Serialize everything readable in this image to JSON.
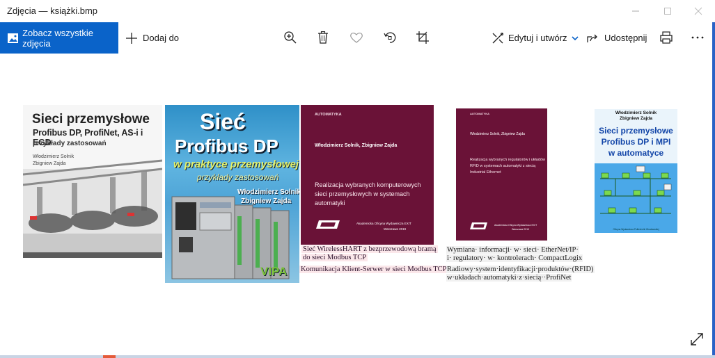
{
  "window": {
    "title": "Zdjęcia — książki.bmp"
  },
  "toolbar": {
    "see_all_label": "Zobacz wszystkie zdjęcia",
    "add_label": "Dodaj do",
    "edit_label": "Edytuj i utwórz",
    "share_label": "Udostępnij",
    "icons": [
      "zoom-icon",
      "delete-icon",
      "favorite-icon",
      "rotate-icon",
      "crop-icon",
      "edit-icon",
      "share-icon",
      "print-icon",
      "more-icon"
    ]
  },
  "colors": {
    "accent": "#0a63c9",
    "book_maroon": "#6a1237",
    "cover_blue": "#4aa8e8"
  },
  "books": {
    "b1": {
      "title_line1": "Sieci przemysłowe",
      "title_line2": "Profibus DP, ProfiNet, AS-i i EGD",
      "subtitle": "przykłady zastosowań",
      "author1": "Włodzimierz Solnik",
      "author2": "Zbigniew Zajda"
    },
    "b2": {
      "title_line1": "Sieć",
      "title_line2": "Profibus DP",
      "title_line3": "w praktyce przemysłowej",
      "subtitle": "przykłady zastosowań",
      "author1": "Włodzimierz Solnik",
      "author2": "Zbigniew Zajda",
      "publisher": "VIPA"
    },
    "b3": {
      "series": "AUTOMATYKA",
      "authors": "Włodzimierz Solnik, Zbigniew Zajda",
      "title": "Realizacja wybranych komputerowych sieci przemysłowych w systemach automatyki",
      "publisher": "Akademicka Oficyna Wydawnicza EXIT",
      "place_year": "Warszawa 2019"
    },
    "b4": {
      "series": "AUTOMATYKA",
      "authors": "Włodzimierz Solnik, Zbigniew Zajda",
      "title": "Realizacja wybranych regulatorów i układów RFID w systemach automatyki z siecią Industrial Ethernet",
      "publisher": "Akademicka Oficyna Wydawnicza EXIT",
      "place_year": "Warszawa 2019"
    },
    "b5": {
      "author1": "Włodzimierz Solnik",
      "author2": "Zbigniew Zajda",
      "title_line1": "Sieci przemysłowe",
      "title_line2": "Profibus DP i MPI",
      "title_line3": "w automatyce",
      "publisher": "Oficyna Wydawnicza Politechniki Wrocławskiej"
    }
  },
  "captions": {
    "c1": "Sieć WirelessHART z bezprzewodową bramą",
    "c2": "do sieci Modbus TCP",
    "c3": "Komunikacja Klient-Serwer w sieci Modbus TCP",
    "c4": "Wymiana· informacji· w· sieci· EtherNet/IP·",
    "c5": "i· regulatory· w· kontrolerach· CompactLogix",
    "c6": "Radiowy·system·identyfikacji·produktów·(RFID)",
    "c7": "w·układach·automatyki·z·siecią··ProfiNet"
  }
}
